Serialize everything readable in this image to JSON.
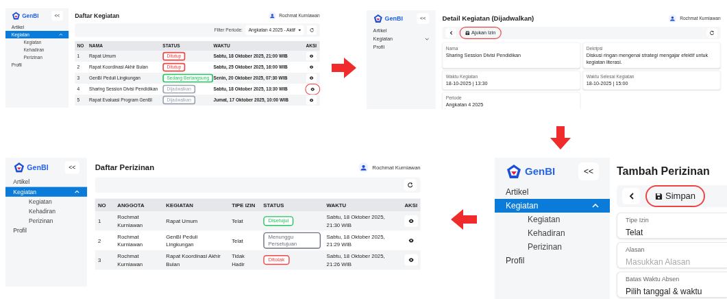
{
  "screens": [
    {
      "kind": "activity_list",
      "sidebar": {
        "brand": "GenBI",
        "collapse": "<<",
        "items": [
          {
            "label": "Artikel",
            "selected": false
          },
          {
            "label": "Kegiatan",
            "selected": true,
            "expanded": true,
            "children": [
              {
                "label": "Kegiatan",
                "selected": false
              },
              {
                "label": "Kehadiran",
                "selected": false
              },
              {
                "label": "Perizinan",
                "selected": false
              }
            ]
          },
          {
            "label": "Profil",
            "selected": false
          }
        ]
      },
      "title": "Daftar Kegiatan",
      "user": "Rochmat Kurniawan",
      "filter": {
        "label": "Filter Periode:",
        "value": "Angkatan 4 2025 - Aktif"
      },
      "columns": [
        "NO",
        "NAMA",
        "STATUS",
        "WAKTU",
        "AKSI"
      ],
      "rows": [
        {
          "no": "1",
          "name": "Rapat Umum",
          "status": "Ditutup",
          "color": "#ef4444",
          "time": "Sabtu, 18 Oktober 2025, 21:00 WIB",
          "highlighted": false
        },
        {
          "no": "2",
          "name": "Rapat Koordinasi Akhir Bulan",
          "status": "Ditutup",
          "color": "#ef4444",
          "time": "Sabtu, 25 Oktober 2025, 16:00 WIB",
          "highlighted": false
        },
        {
          "no": "3",
          "name": "GenBI Peduli Lingkungan",
          "status": "Sedang Berlangsung",
          "color": "#22c55e",
          "time": "Senin, 20 Oktober 2025, 07:30 WIB",
          "highlighted": false
        },
        {
          "no": "4",
          "name": "Sharing Session Divisi Pendidikan",
          "status": "Dijadwalkan",
          "color": "#9ca3af",
          "time": "Sabtu, 18 Oktober 2025, 13:30 WIB",
          "highlighted": true
        },
        {
          "no": "5",
          "name": "Rapat Evaluasi Program GenBI",
          "status": "Dijadwalkan",
          "color": "#9ca3af",
          "time": "Jumat, 17 Oktober 2025, 10:00 WIB",
          "highlighted": false
        }
      ]
    },
    {
      "kind": "activity_detail",
      "sidebar": {
        "brand": "GenBI",
        "collapse": "<<",
        "items": [
          {
            "label": "Artikel",
            "selected": false
          },
          {
            "label": "Kegiatan",
            "selected": false,
            "expanded": false
          },
          {
            "label": "Profil",
            "selected": false
          }
        ]
      },
      "title": "Detail Kegiatan (Dijadwalkan)",
      "user": "Rochmat Kurniawan",
      "action": {
        "label": "Ajukan Izin",
        "highlighted": true
      },
      "fields": [
        {
          "label": "Nama",
          "value": "Sharing Session Divisi Pendidikan"
        },
        {
          "label": "Dekripsi",
          "value": "Diskusi ringan mengenai strategi mengajar efektif untuk kegiatan literasi."
        },
        {
          "label": "Waktu Kegiatan",
          "value": "18-10-2025 | 13:30"
        },
        {
          "label": "Waktu Selesai Kegiatan",
          "value": "18-10-2025 | 15:00"
        },
        {
          "label": "Periode",
          "value": "Angkatan 4 2025"
        }
      ]
    },
    {
      "kind": "permission_list",
      "sidebar": {
        "brand": "GenBI",
        "collapse": "<<",
        "items": [
          {
            "label": "Artikel",
            "selected": false
          },
          {
            "label": "Kegiatan",
            "selected": true,
            "expanded": true,
            "children": [
              {
                "label": "Kegiatan",
                "selected": false
              },
              {
                "label": "Kehadiran",
                "selected": false
              },
              {
                "label": "Perizinan",
                "selected": false
              }
            ]
          },
          {
            "label": "Profil",
            "selected": false
          }
        ]
      },
      "title": "Daftar Perizinan",
      "user": "Rochmat Kurniawan",
      "columns": [
        "NO",
        "ANGGOTA",
        "KEGIATAN",
        "TIPE IZIN",
        "STATUS",
        "WAKTU",
        "AKSI"
      ],
      "rows": [
        {
          "no": "1",
          "member": "Rochmat Kurniawan",
          "activity": "Rapat Umum",
          "type": "Telat",
          "status": "Disetujui",
          "color": "#22c55e",
          "time": "Sabtu, 18 Oktober 2025, 21:30 WIB"
        },
        {
          "no": "2",
          "member": "Rochmat Kurniawan",
          "activity": "GenBI Peduli Lingkungan",
          "type": "Telat",
          "status": "Menunggu Persetujuan",
          "color": "#6b7280",
          "time": "Sabtu, 18 Oktober 2025, 21:29 WIB"
        },
        {
          "no": "3",
          "member": "Rochmat Kurniawan",
          "activity": "Rapat Koordinasi Akhir Bulan",
          "type": "Tidak Hadir",
          "status": "Ditolak",
          "color": "#ef4444",
          "time": "Sabtu, 18 Oktober 2025, 21:26 WIB"
        }
      ]
    },
    {
      "kind": "permission_form",
      "sidebar": {
        "brand": "GenBI",
        "collapse": "<<",
        "items": [
          {
            "label": "Artikel",
            "selected": false
          },
          {
            "label": "Kegiatan",
            "selected": true,
            "expanded": true,
            "children": [
              {
                "label": "Kegiatan",
                "selected": false
              },
              {
                "label": "Kehadiran",
                "selected": false
              },
              {
                "label": "Perizinan",
                "selected": false
              }
            ]
          },
          {
            "label": "Profil",
            "selected": false
          }
        ]
      },
      "title": "Tambah Perizinan",
      "action": {
        "label": "Simpan",
        "highlighted": true
      },
      "fields": [
        {
          "label": "Tipe Izin",
          "value": "Telat"
        },
        {
          "label": "Alasan",
          "placeholder": "Masukkan Alasan"
        },
        {
          "label": "Batas Waktu Absen",
          "value": "Pilih tanggal & waktu"
        }
      ]
    }
  ]
}
